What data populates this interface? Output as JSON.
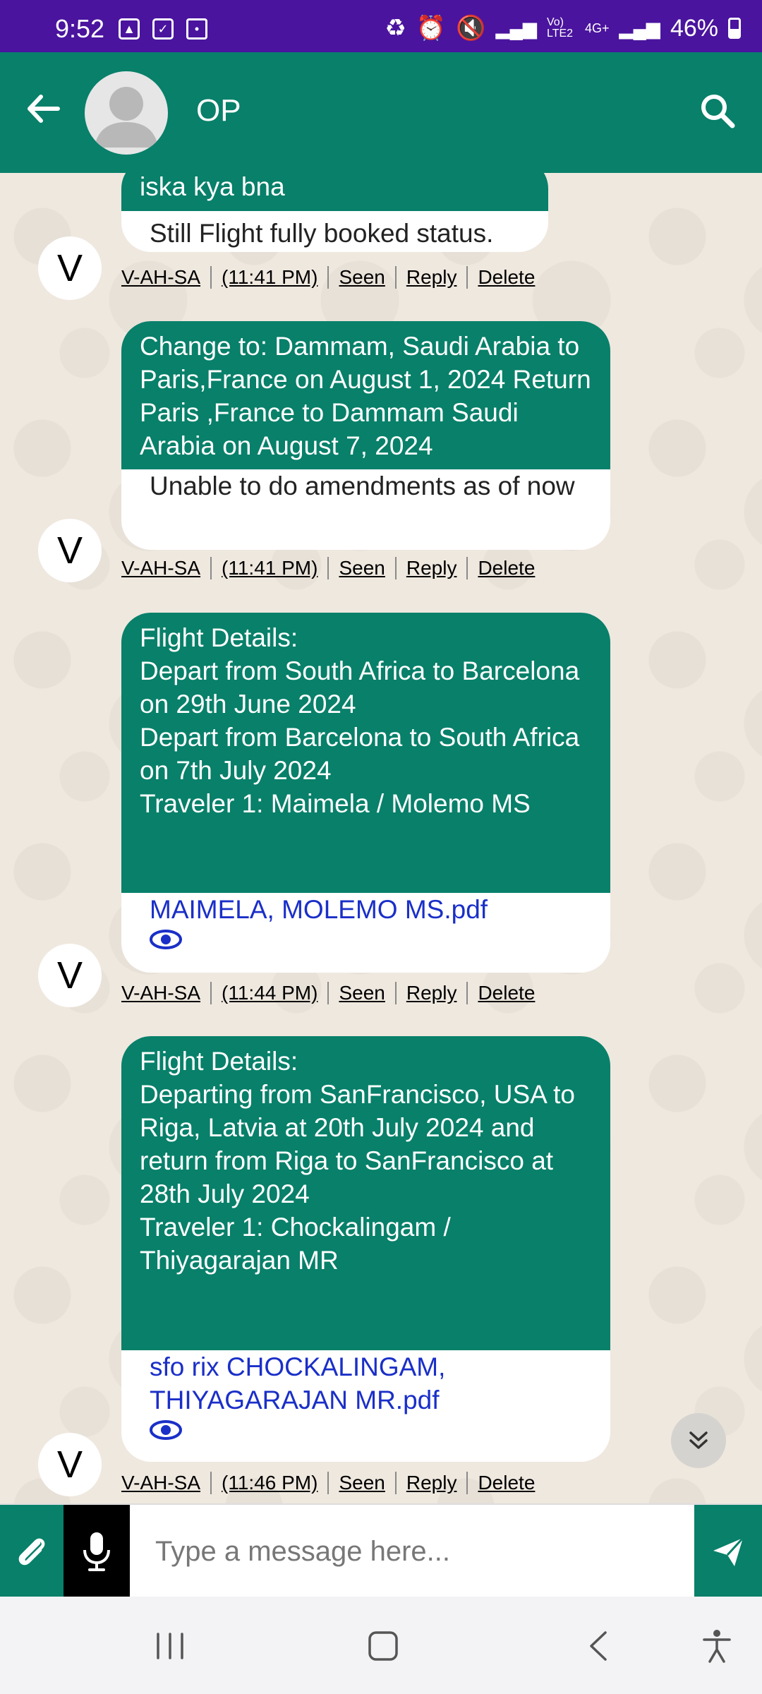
{
  "status_bar": {
    "time": "9:52",
    "network_label": "4G+",
    "volte_label": "Vo) LTE2",
    "battery": "46%"
  },
  "header": {
    "title": "OP"
  },
  "messages": [
    {
      "sender_initial": "V",
      "green_text": "iska kya bna",
      "white_text": "Still Flight fully booked status.",
      "link": "",
      "meta": {
        "sender": "V-AH-SA",
        "time": "(11:41 PM)",
        "seen": "Seen",
        "reply": "Reply",
        "delete": "Delete"
      }
    },
    {
      "sender_initial": "V",
      "green_text": "Change to: Dammam, Saudi Arabia to Paris,France on August 1, 2024 Return Paris ,France to Dammam Saudi Arabia on August 7, 2024",
      "white_text": "Unable to do amendments as of now",
      "link": "",
      "meta": {
        "sender": "V-AH-SA",
        "time": "(11:41 PM)",
        "seen": "Seen",
        "reply": "Reply",
        "delete": "Delete"
      }
    },
    {
      "sender_initial": "V",
      "green_text": "Flight Details:\nDepart from South Africa to Barcelona on 29th June 2024\nDepart from Barcelona to South Africa on 7th July 2024\nTraveler 1: Maimela / Molemo MS",
      "white_text": "",
      "link": "MAIMELA, MOLEMO MS.pdf",
      "meta": {
        "sender": "V-AH-SA",
        "time": "(11:44 PM)",
        "seen": "Seen",
        "reply": "Reply",
        "delete": "Delete"
      }
    },
    {
      "sender_initial": "V",
      "green_text": "Flight Details:\nDeparting from SanFrancisco, USA to Riga, Latvia at 20th July 2024 and return from Riga to SanFrancisco at 28th July 2024\nTraveler 1: Chockalingam / Thiyagarajan MR",
      "white_text": "",
      "link": "sfo rix CHOCKALINGAM, THIYAGARAJAN MR.pdf",
      "meta": {
        "sender": "V-AH-SA",
        "time": "(11:46 PM)",
        "seen": "Seen",
        "reply": "Reply",
        "delete": "Delete"
      }
    }
  ],
  "composer": {
    "placeholder": "Type a message here..."
  },
  "colors": {
    "status_bar": "#4a149e",
    "header": "#08806a",
    "bubble_green": "#08806a",
    "link": "#1a2fc8"
  }
}
